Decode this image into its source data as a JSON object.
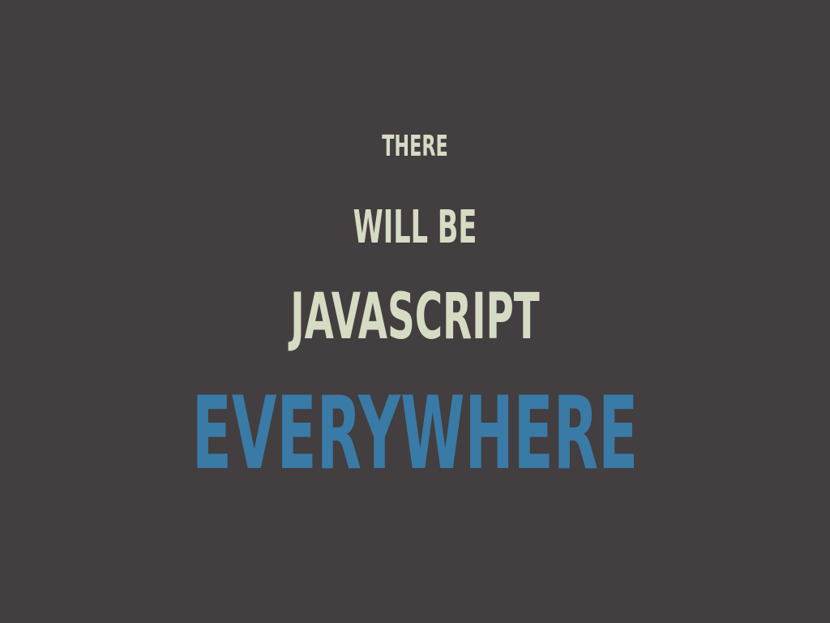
{
  "slide": {
    "line1": "THERE",
    "line2": "WILL BE",
    "line3": "JAVASCRIPT",
    "line4": "EVERYWHERE"
  },
  "colors": {
    "background": "#433e3f",
    "text": "#d6dbc4",
    "accent": "#3a7aa6"
  }
}
